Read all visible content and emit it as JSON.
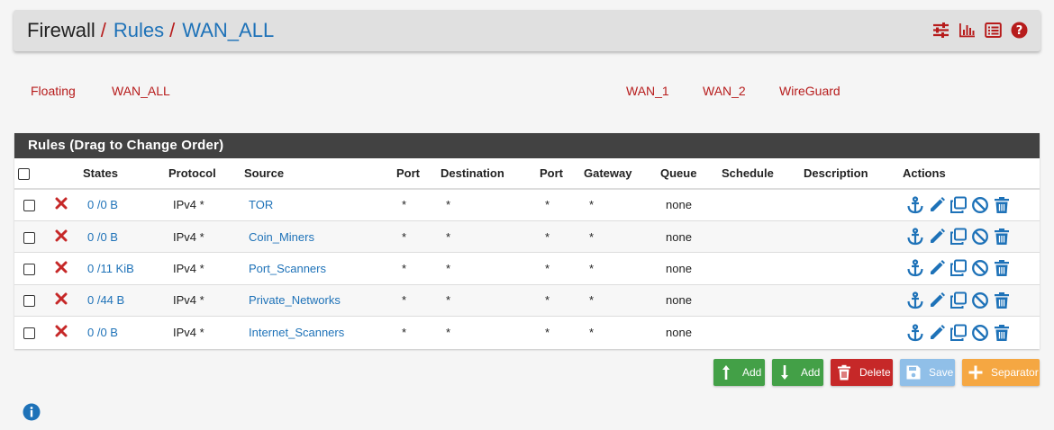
{
  "breadcrumb": {
    "root": "Firewall",
    "sep": "/",
    "level2": "Rules",
    "level3": "WAN_ALL"
  },
  "header_icons": [
    "sliders-icon",
    "bar-chart-icon",
    "list-icon",
    "help-icon"
  ],
  "tabs": [
    {
      "label": "Floating"
    },
    {
      "label": "WAN_ALL"
    },
    {
      "label": "WAN_1"
    },
    {
      "label": "WAN_2"
    },
    {
      "label": "WireGuard"
    }
  ],
  "panel": {
    "title": "Rules (Drag to Change Order)",
    "columns": [
      "States",
      "Protocol",
      "Source",
      "Port",
      "Destination",
      "Port",
      "Gateway",
      "Queue",
      "Schedule",
      "Description",
      "Actions"
    ],
    "rows": [
      {
        "states": "0 /0 B",
        "protocol": "IPv4 *",
        "source": "TOR",
        "port": "*",
        "destination": "*",
        "dport": "*",
        "gateway": "*",
        "queue": "none",
        "schedule": "",
        "description": ""
      },
      {
        "states": "0 /0 B",
        "protocol": "IPv4 *",
        "source": "Coin_Miners",
        "port": "*",
        "destination": "*",
        "dport": "*",
        "gateway": "*",
        "queue": "none",
        "schedule": "",
        "description": ""
      },
      {
        "states": "0 /11 KiB",
        "protocol": "IPv4 *",
        "source": "Port_Scanners",
        "port": "*",
        "destination": "*",
        "dport": "*",
        "gateway": "*",
        "queue": "none",
        "schedule": "",
        "description": ""
      },
      {
        "states": "0 /44 B",
        "protocol": "IPv4 *",
        "source": "Private_Networks",
        "port": "*",
        "destination": "*",
        "dport": "*",
        "gateway": "*",
        "queue": "none",
        "schedule": "",
        "description": ""
      },
      {
        "states": "0 /0 B",
        "protocol": "IPv4 *",
        "source": "Internet_Scanners",
        "port": "*",
        "destination": "*",
        "dport": "*",
        "gateway": "*",
        "queue": "none",
        "schedule": "",
        "description": ""
      }
    ],
    "row_status_icon": "block-x-icon",
    "row_action_icons": [
      "anchor-icon",
      "pencil-icon",
      "copy-icon",
      "disable-icon",
      "trash-icon"
    ]
  },
  "buttons": {
    "add_top": "Add",
    "add_bottom": "Add",
    "delete": "Delete",
    "save": "Save",
    "separator": "Separator"
  },
  "colors": {
    "accent_red": "#b71c1c",
    "link_blue": "#1e72b8",
    "green": "#43a047",
    "red_button": "#c62828",
    "save_blue": "#90bfe8",
    "separator_orange": "#f5a742",
    "panel_heading": "#424242"
  }
}
